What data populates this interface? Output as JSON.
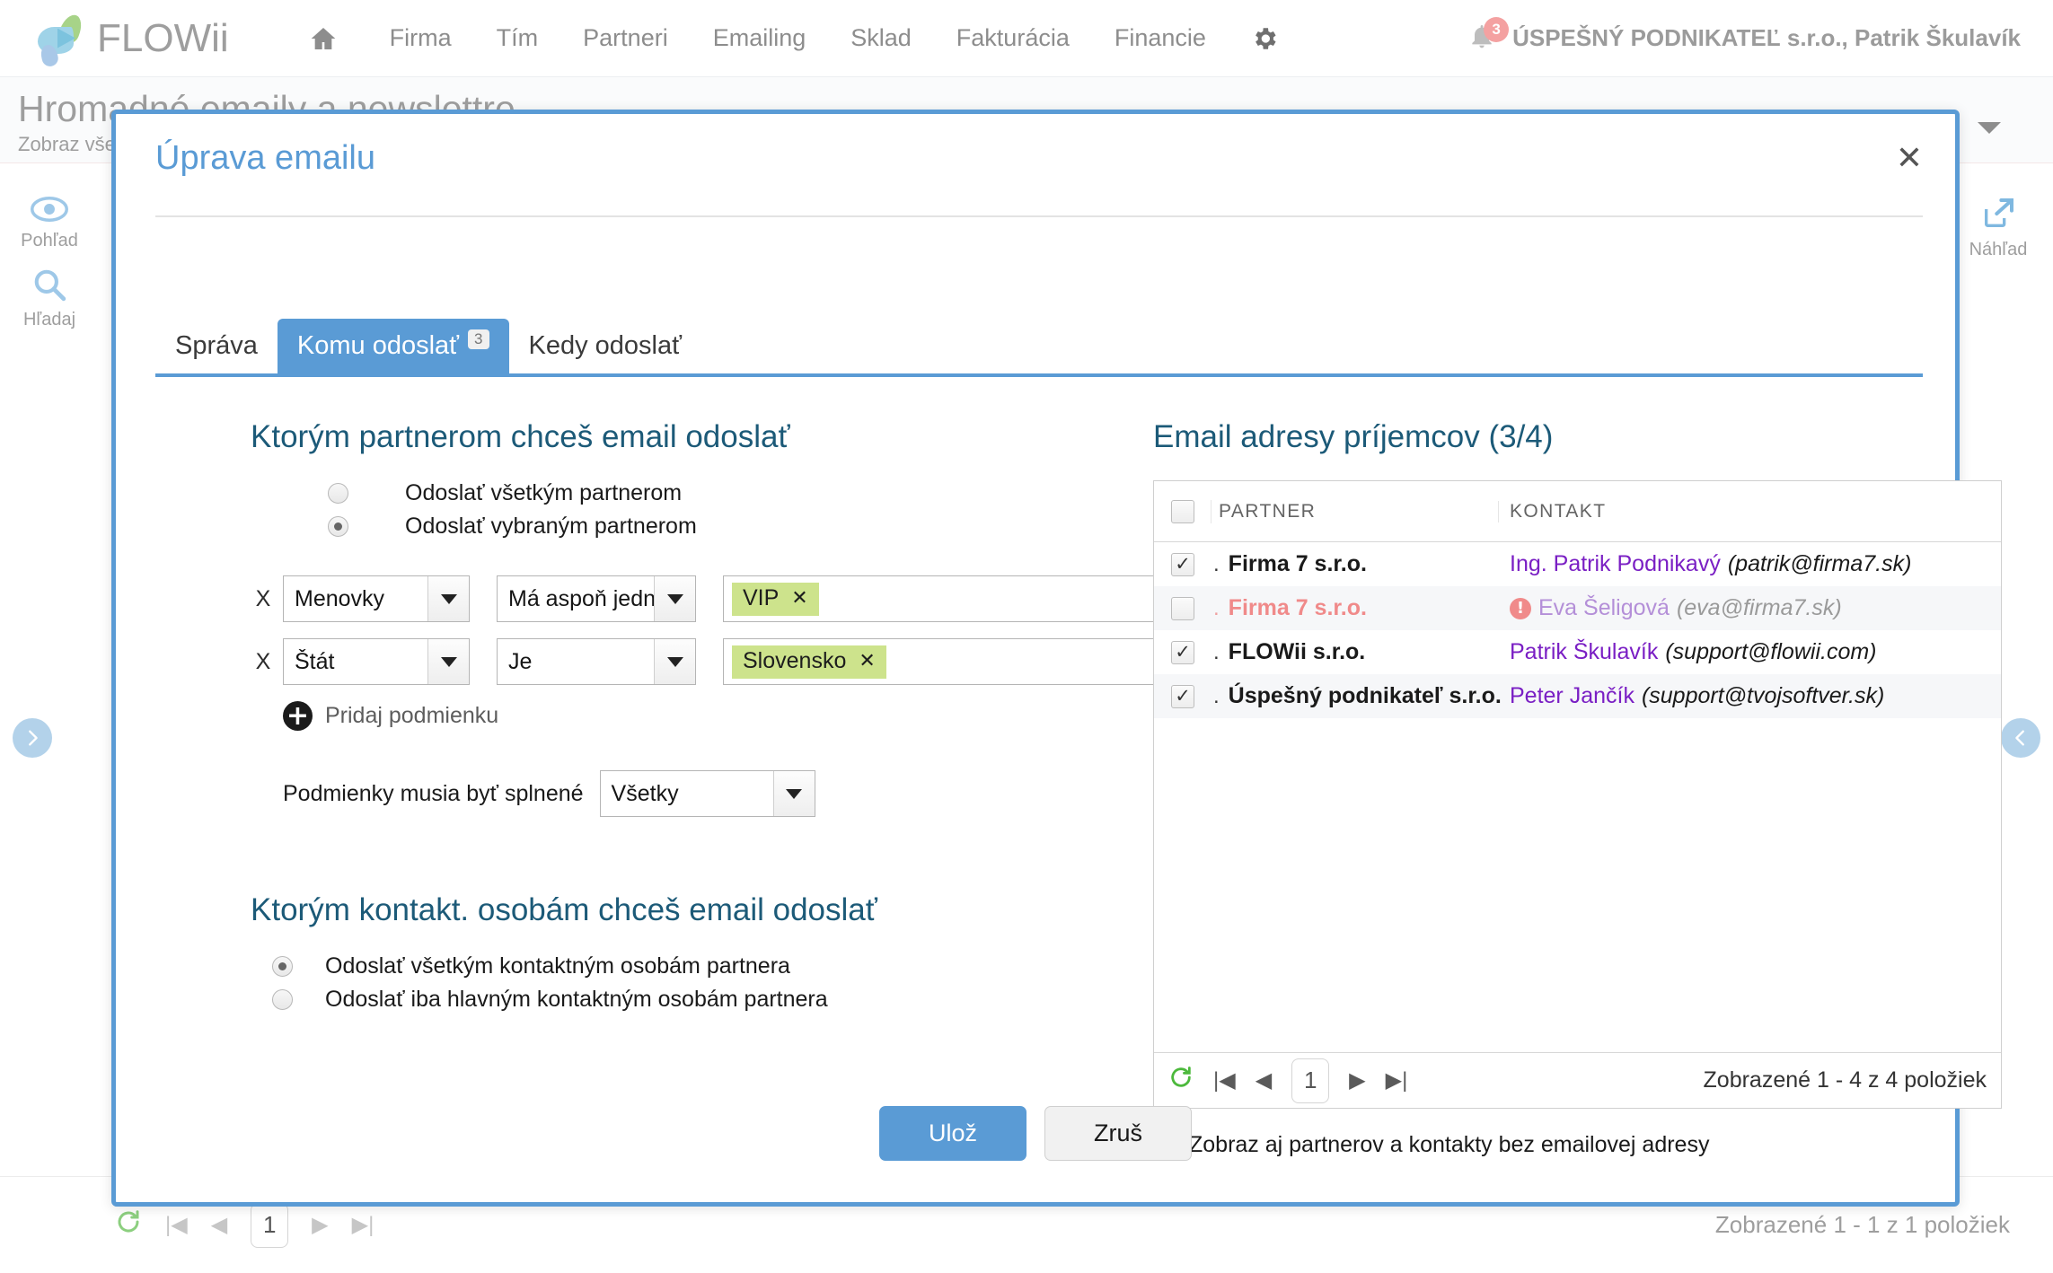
{
  "topnav": {
    "brand": "FLOWii",
    "home_icon": "home-icon",
    "items": [
      "Firma",
      "Tím",
      "Partneri",
      "Emailing",
      "Sklad",
      "Fakturácia",
      "Financie"
    ],
    "gear_icon": "gear-icon",
    "bell_icon": "bell-icon",
    "bell_badge": "3",
    "user_name": "ÚSPEŠNÝ PODNIKATEĽ s.r.o., Patrik Škulavík"
  },
  "background_page": {
    "title": "Hromadné emaily a newslettre",
    "subtitle": "Zobraz všetky",
    "help": "?",
    "tools": [
      {
        "name": "Pohľad",
        "icon": "eye-icon"
      },
      {
        "name": "Hľadaj",
        "icon": "search-icon"
      },
      {
        "name": "Náhľad",
        "icon": "external-link-icon"
      }
    ],
    "footer": {
      "page": "1",
      "status": "Zobrazené 1 - 1 z 1 položiek"
    }
  },
  "modal": {
    "title": "Úprava emailu",
    "close_icon": "close-icon",
    "tabs": [
      {
        "label": "Správa",
        "badge": "",
        "active": false
      },
      {
        "label": "Komu odoslať",
        "badge": "3",
        "active": true
      },
      {
        "label": "Kedy odoslať",
        "badge": "",
        "active": false
      }
    ],
    "partners_section": {
      "heading": "Ktorým partnerom chceš email odoslať",
      "options": [
        {
          "label": "Odoslať všetkým partnerom",
          "selected": false
        },
        {
          "label": "Odoslať vybraným partnerom",
          "selected": true
        }
      ],
      "conditions": [
        {
          "remove_label": "X",
          "field": "Menovky",
          "operator": "Má aspoň jednu",
          "tag": "VIP"
        },
        {
          "remove_label": "X",
          "field": "Štát",
          "operator": "Je",
          "tag": "Slovensko"
        }
      ],
      "add_condition_label": "Pridaj podmienku",
      "add_condition_icon": "plus-icon",
      "match_label": "Podmienky musia byť splnené",
      "match_value": "Všetky"
    },
    "contacts_section": {
      "heading": "Ktorým kontakt. osobám chceš email odoslať",
      "options": [
        {
          "label": "Odoslať všetkým kontaktným osobám partnera",
          "selected": true
        },
        {
          "label": "Odoslať iba hlavným kontaktným osobám partnera",
          "selected": false
        }
      ]
    },
    "recipients": {
      "heading": "Email adresy príjemcov (3/4)",
      "columns": [
        "PARTNER",
        "KONTAKT"
      ],
      "header_checkbox_checked": false,
      "rows": [
        {
          "checked": true,
          "dot": ".",
          "partner": "Firma 7 s.r.o.",
          "contact_name": "Ing. Patrik Podnikavý",
          "contact_email": "(patrik@firma7.sk)",
          "disabled": false,
          "warning": false
        },
        {
          "checked": false,
          "dot": ".",
          "partner": "Firma 7 s.r.o.",
          "contact_name": "Eva Šeligová",
          "contact_email": "(eva@firma7.sk)",
          "disabled": true,
          "warning": true
        },
        {
          "checked": true,
          "dot": ".",
          "partner": "FLOWii s.r.o.",
          "contact_name": "Patrik Škulavík",
          "contact_email": "(support@flowii.com)",
          "disabled": false,
          "warning": false
        },
        {
          "checked": true,
          "dot": ".",
          "partner": "Úspešný podnikateľ s.r.o.",
          "contact_name": "Peter Jančík",
          "contact_email": "(support@tvojsoftver.sk)",
          "disabled": false,
          "warning": false
        }
      ],
      "footer": {
        "refresh_icon": "refresh-icon",
        "page": "1",
        "status": "Zobrazené 1 - 4 z 4 položiek"
      },
      "show_without_email_label": "Zobraz aj partnerov a kontakty bez emailovej adresy",
      "show_without_email_checked": false
    },
    "buttons": {
      "save": "Ulož",
      "cancel": "Zruš"
    }
  },
  "colors": {
    "accent": "#5a9bd5",
    "heading": "#1c5a78",
    "tag_bg": "#cde38c",
    "link": "#7a1fc4",
    "warning": "#f08a8a"
  }
}
